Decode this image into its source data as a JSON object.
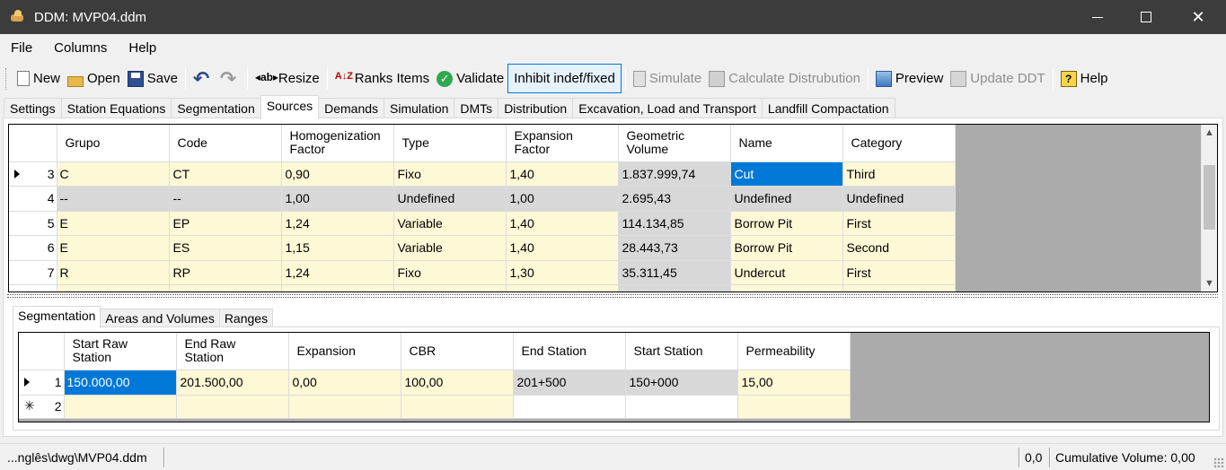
{
  "window": {
    "title": "DDM: MVP04.ddm"
  },
  "menu": [
    "File",
    "Columns",
    "Help"
  ],
  "toolbar": {
    "new": "New",
    "open": "Open",
    "save": "Save",
    "resize": "Resize",
    "ranks": "Ranks Items",
    "validate": "Validate",
    "inhibit": "Inhibit indef/fixed",
    "simulate": "Simulate",
    "calculate": "Calculate Distrubution",
    "preview": "Preview",
    "update": "Update DDT",
    "help": "Help"
  },
  "tabs": [
    "Settings",
    "Station Equations",
    "Segmentation",
    "Sources",
    "Demands",
    "Simulation",
    "DMTs",
    "Distribution",
    "Excavation, Load and Transport",
    "Landfill Compactation"
  ],
  "sources": {
    "headers": [
      "Grupo",
      "Code",
      "Homogenization Factor",
      "Type",
      "Expansion Factor",
      "Geometric Volume",
      "Name",
      "Category"
    ],
    "header_lines": [
      [
        "Grupo"
      ],
      [
        "Code"
      ],
      [
        "Homogenization",
        "Factor"
      ],
      [
        "Type"
      ],
      [
        "Expansion",
        "Factor"
      ],
      [
        "Geometric",
        "Volume"
      ],
      [
        "Name"
      ],
      [
        "Category"
      ]
    ],
    "rows": [
      {
        "num": "3",
        "cells": [
          "C",
          "CT",
          "0,90",
          "Fixo",
          "1,40",
          "1.837.999,74",
          "Cut",
          "Third"
        ]
      },
      {
        "num": "4",
        "cells": [
          "--",
          "--",
          "1,00",
          "Undefined",
          "1,00",
          "2.695,43",
          "Undefined",
          "Undefined"
        ]
      },
      {
        "num": "5",
        "cells": [
          "E",
          "EP",
          "1,24",
          "Variable",
          "1,40",
          "114.134,85",
          "Borrow Pit",
          "First"
        ]
      },
      {
        "num": "6",
        "cells": [
          "E",
          "ES",
          "1,15",
          "Variable",
          "1,40",
          "28.443,73",
          "Borrow Pit",
          "Second"
        ]
      },
      {
        "num": "7",
        "cells": [
          "R",
          "RP",
          "1,24",
          "Fixo",
          "1,30",
          "35.311,45",
          "Undercut",
          "First"
        ]
      }
    ]
  },
  "subtabs": [
    "Segmentation",
    "Areas and Volumes",
    "Ranges"
  ],
  "segmentation": {
    "header_lines": [
      [
        "Start Raw",
        "Station"
      ],
      [
        "End Raw",
        "Station"
      ],
      [
        "Expansion"
      ],
      [
        "CBR"
      ],
      [
        "End Station"
      ],
      [
        "Start Station"
      ],
      [
        "Permeability"
      ]
    ],
    "rows": [
      {
        "num": "1",
        "cells": [
          "150.000,00",
          "201.500,00",
          "0,00",
          "100,00",
          "201+500",
          "150+000",
          "15,00"
        ]
      },
      {
        "num": "2",
        "cells": [
          "",
          "",
          "",
          "",
          "",
          "",
          ""
        ]
      }
    ]
  },
  "status": {
    "path": "...nglês\\dwg\\MVP04.ddm",
    "coord": "0,0",
    "cumulative": "Cumulative Volume: 0,00"
  }
}
